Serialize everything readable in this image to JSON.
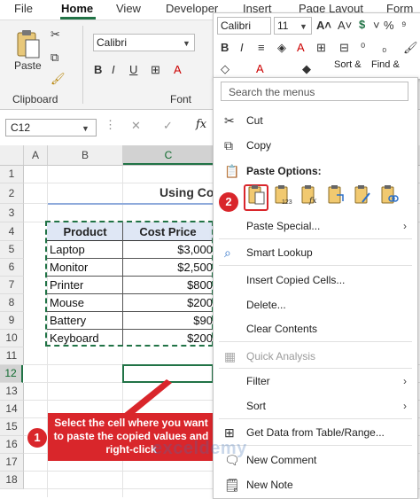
{
  "ribbon": {
    "tabs": [
      "File",
      "Home",
      "View",
      "Developer",
      "Insert",
      "Page Layout",
      "Form"
    ],
    "active_tab": "Home",
    "clipboard": {
      "paste_label": "Paste",
      "group_label": "Clipboard"
    },
    "font": {
      "family": "Calibri",
      "group_label": "Font"
    },
    "accent_color": "#217346"
  },
  "mini_toolbar": {
    "font_family": "Calibri",
    "font_size": "11",
    "buttons": [
      "B",
      "I",
      "%",
      "Sort &",
      "Find &"
    ]
  },
  "formula_bar": {
    "name_box": "C12",
    "fx": "fx"
  },
  "grid": {
    "columns": [
      "A",
      "B",
      "C"
    ],
    "rows": [
      "1",
      "2",
      "3",
      "4",
      "5",
      "6",
      "7",
      "8",
      "9",
      "10",
      "11",
      "12",
      "13",
      "14",
      "15",
      "16",
      "17",
      "18"
    ],
    "selected_cell": "C12",
    "title_partial": "Using Co",
    "table": {
      "headers": [
        "Product",
        "Cost Price"
      ],
      "rows": [
        [
          "Laptop",
          "$3,000"
        ],
        [
          "Monitor",
          "$2,500"
        ],
        [
          "Printer",
          "$800"
        ],
        [
          "Mouse",
          "$200"
        ],
        [
          "Battery",
          "$90"
        ],
        [
          "Keyboard",
          "$200"
        ]
      ]
    }
  },
  "context_menu": {
    "search_placeholder": "Search the menus",
    "cut": "Cut",
    "copy": "Copy",
    "paste_options_label": "Paste Options:",
    "paste_special": "Paste Special...",
    "smart_lookup": "Smart Lookup",
    "insert_copied_cells": "Insert Copied Cells...",
    "delete": "Delete...",
    "clear_contents": "Clear Contents",
    "quick_analysis": "Quick Analysis",
    "filter": "Filter",
    "sort": "Sort",
    "get_data": "Get Data from Table/Range...",
    "new_comment": "New Comment",
    "new_note": "New Note"
  },
  "callouts": {
    "step1_number": "1",
    "step1_text": "Select the cell where you want to paste the copied values and right-click",
    "step2_number": "2",
    "color": "#d9262b"
  },
  "watermark": "exceldemy"
}
